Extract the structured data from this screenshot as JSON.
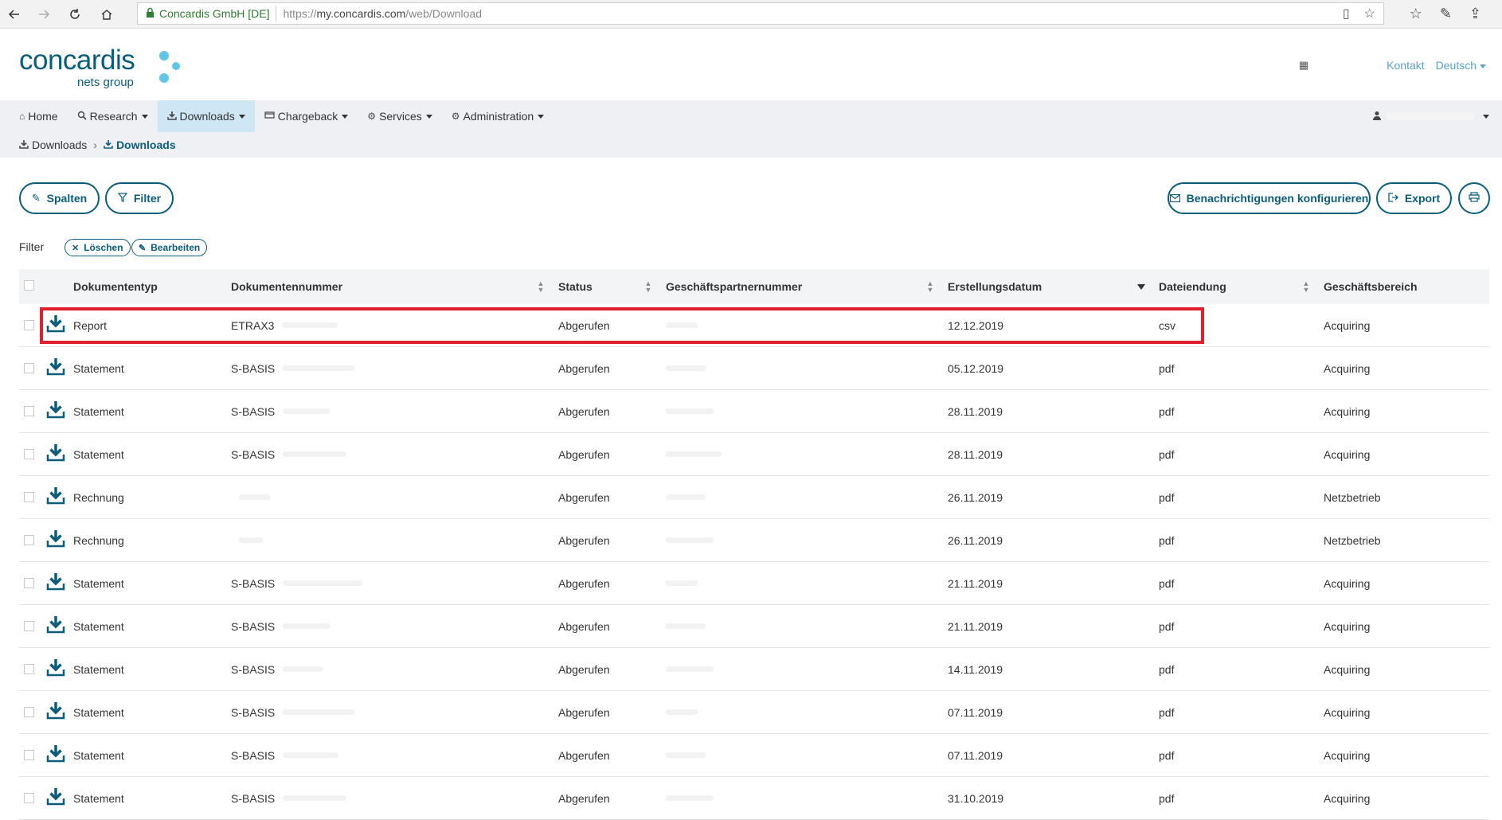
{
  "browser": {
    "cert_label": "Concardis GmbH [DE]",
    "url_prefix": "https://",
    "url_host": "my.concardis.com",
    "url_path": "/web/Download"
  },
  "header": {
    "logo_main": "concardis",
    "logo_sub": "nets group",
    "kontakt": "Kontakt",
    "language": "Deutsch"
  },
  "nav": {
    "items": [
      {
        "label": "Home",
        "icon": "home-icon"
      },
      {
        "label": "Research",
        "icon": "search-icon"
      },
      {
        "label": "Downloads",
        "icon": "download-icon"
      },
      {
        "label": "Chargeback",
        "icon": "card-icon"
      },
      {
        "label": "Services",
        "icon": "gears-icon"
      },
      {
        "label": "Administration",
        "icon": "gear-icon"
      }
    ]
  },
  "breadcrumb": {
    "first": "Downloads",
    "current": "Downloads"
  },
  "toolbar": {
    "spalten": "Spalten",
    "filter": "Filter",
    "notifications": "Benachrichtigungen konfigurieren",
    "export": "Export"
  },
  "filter_bar": {
    "label": "Filter",
    "clear": "Löschen",
    "edit": "Bearbeiten"
  },
  "table": {
    "headers": {
      "type": "Dokumententyp",
      "number": "Dokumentennummer",
      "status": "Status",
      "partner": "Geschäftspartnernummer",
      "date": "Erstellungsdatum",
      "ext": "Dateiendung",
      "area": "Geschäftsbereich"
    },
    "rows": [
      {
        "type": "Report",
        "number": "ETRAX3",
        "status": "Abgerufen",
        "date": "12.12.2019",
        "ext": "csv",
        "area": "Acquiring"
      },
      {
        "type": "Statement",
        "number": "S-BASIS",
        "status": "Abgerufen",
        "date": "05.12.2019",
        "ext": "pdf",
        "area": "Acquiring"
      },
      {
        "type": "Statement",
        "number": "S-BASIS",
        "status": "Abgerufen",
        "date": "28.11.2019",
        "ext": "pdf",
        "area": "Acquiring"
      },
      {
        "type": "Statement",
        "number": "S-BASIS",
        "status": "Abgerufen",
        "date": "28.11.2019",
        "ext": "pdf",
        "area": "Acquiring"
      },
      {
        "type": "Rechnung",
        "number": "",
        "status": "Abgerufen",
        "date": "26.11.2019",
        "ext": "pdf",
        "area": "Netzbetrieb"
      },
      {
        "type": "Rechnung",
        "number": "",
        "status": "Abgerufen",
        "date": "26.11.2019",
        "ext": "pdf",
        "area": "Netzbetrieb"
      },
      {
        "type": "Statement",
        "number": "S-BASIS",
        "status": "Abgerufen",
        "date": "21.11.2019",
        "ext": "pdf",
        "area": "Acquiring"
      },
      {
        "type": "Statement",
        "number": "S-BASIS",
        "status": "Abgerufen",
        "date": "21.11.2019",
        "ext": "pdf",
        "area": "Acquiring"
      },
      {
        "type": "Statement",
        "number": "S-BASIS",
        "status": "Abgerufen",
        "date": "14.11.2019",
        "ext": "pdf",
        "area": "Acquiring"
      },
      {
        "type": "Statement",
        "number": "S-BASIS",
        "status": "Abgerufen",
        "date": "07.11.2019",
        "ext": "pdf",
        "area": "Acquiring"
      },
      {
        "type": "Statement",
        "number": "S-BASIS",
        "status": "Abgerufen",
        "date": "07.11.2019",
        "ext": "pdf",
        "area": "Acquiring"
      },
      {
        "type": "Statement",
        "number": "S-BASIS",
        "status": "Abgerufen",
        "date": "31.10.2019",
        "ext": "pdf",
        "area": "Acquiring"
      }
    ]
  },
  "colors": {
    "brand": "#0b5d7c",
    "brand_dots": "#5ec7e8",
    "highlight": "#e0202f",
    "nav_active": "#cfe6f5"
  }
}
